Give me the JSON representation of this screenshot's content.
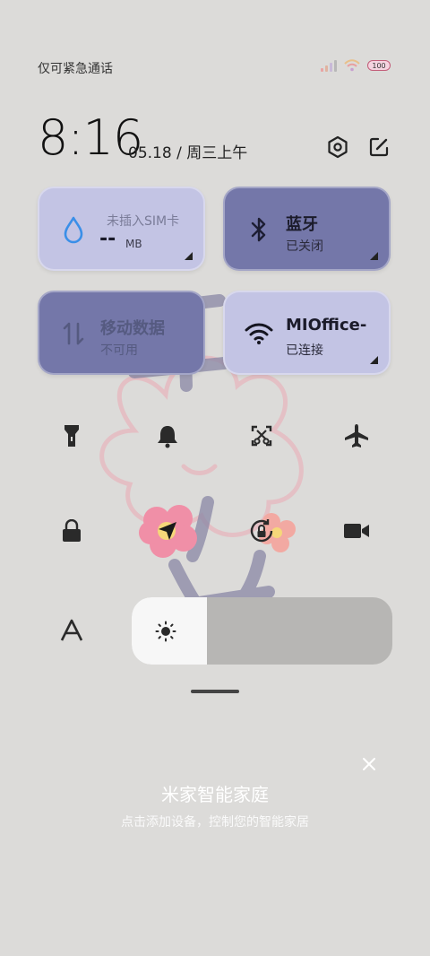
{
  "status_bar": {
    "carrier_text": "仅可紧急通话",
    "battery_level": "100",
    "signal_icon": "cellular-signal-icon",
    "wifi_icon": "wifi-icon"
  },
  "header": {
    "time": "8:16",
    "date": "05.18 / 周三上午",
    "settings_icon": "settings-icon",
    "edit_icon": "edit-icon"
  },
  "tiles": {
    "data_usage": {
      "title": "未插入SIM卡",
      "value": "--",
      "unit": "MB",
      "icon": "water-drop-icon"
    },
    "bluetooth": {
      "title": "蓝牙",
      "sub": "已关闭",
      "icon": "bluetooth-icon"
    },
    "mobile_data": {
      "title": "移动数据",
      "sub": "不可用",
      "icon": "mobile-data-icon"
    },
    "wifi": {
      "title": "MIOffice-",
      "sub": "已连接",
      "icon": "wifi-icon"
    }
  },
  "toggles": [
    {
      "name": "flashlight-icon"
    },
    {
      "name": "bell-icon"
    },
    {
      "name": "screenshot-icon"
    },
    {
      "name": "airplane-icon"
    },
    {
      "name": "lock-icon"
    },
    {
      "name": "location-icon"
    },
    {
      "name": "rotation-lock-icon"
    },
    {
      "name": "video-camera-icon"
    },
    {
      "name": "font-size-icon"
    }
  ],
  "brightness": {
    "level": 0.29,
    "icon": "brightness-icon"
  },
  "mi_home": {
    "title": "米家智能家庭",
    "subtitle": "点击添加设备，控制您的智能家居",
    "close_icon": "close-icon"
  },
  "colors": {
    "tile_light": "#c3c4e4",
    "tile_dark": "#7477a9",
    "background": "#dcdbd9"
  }
}
